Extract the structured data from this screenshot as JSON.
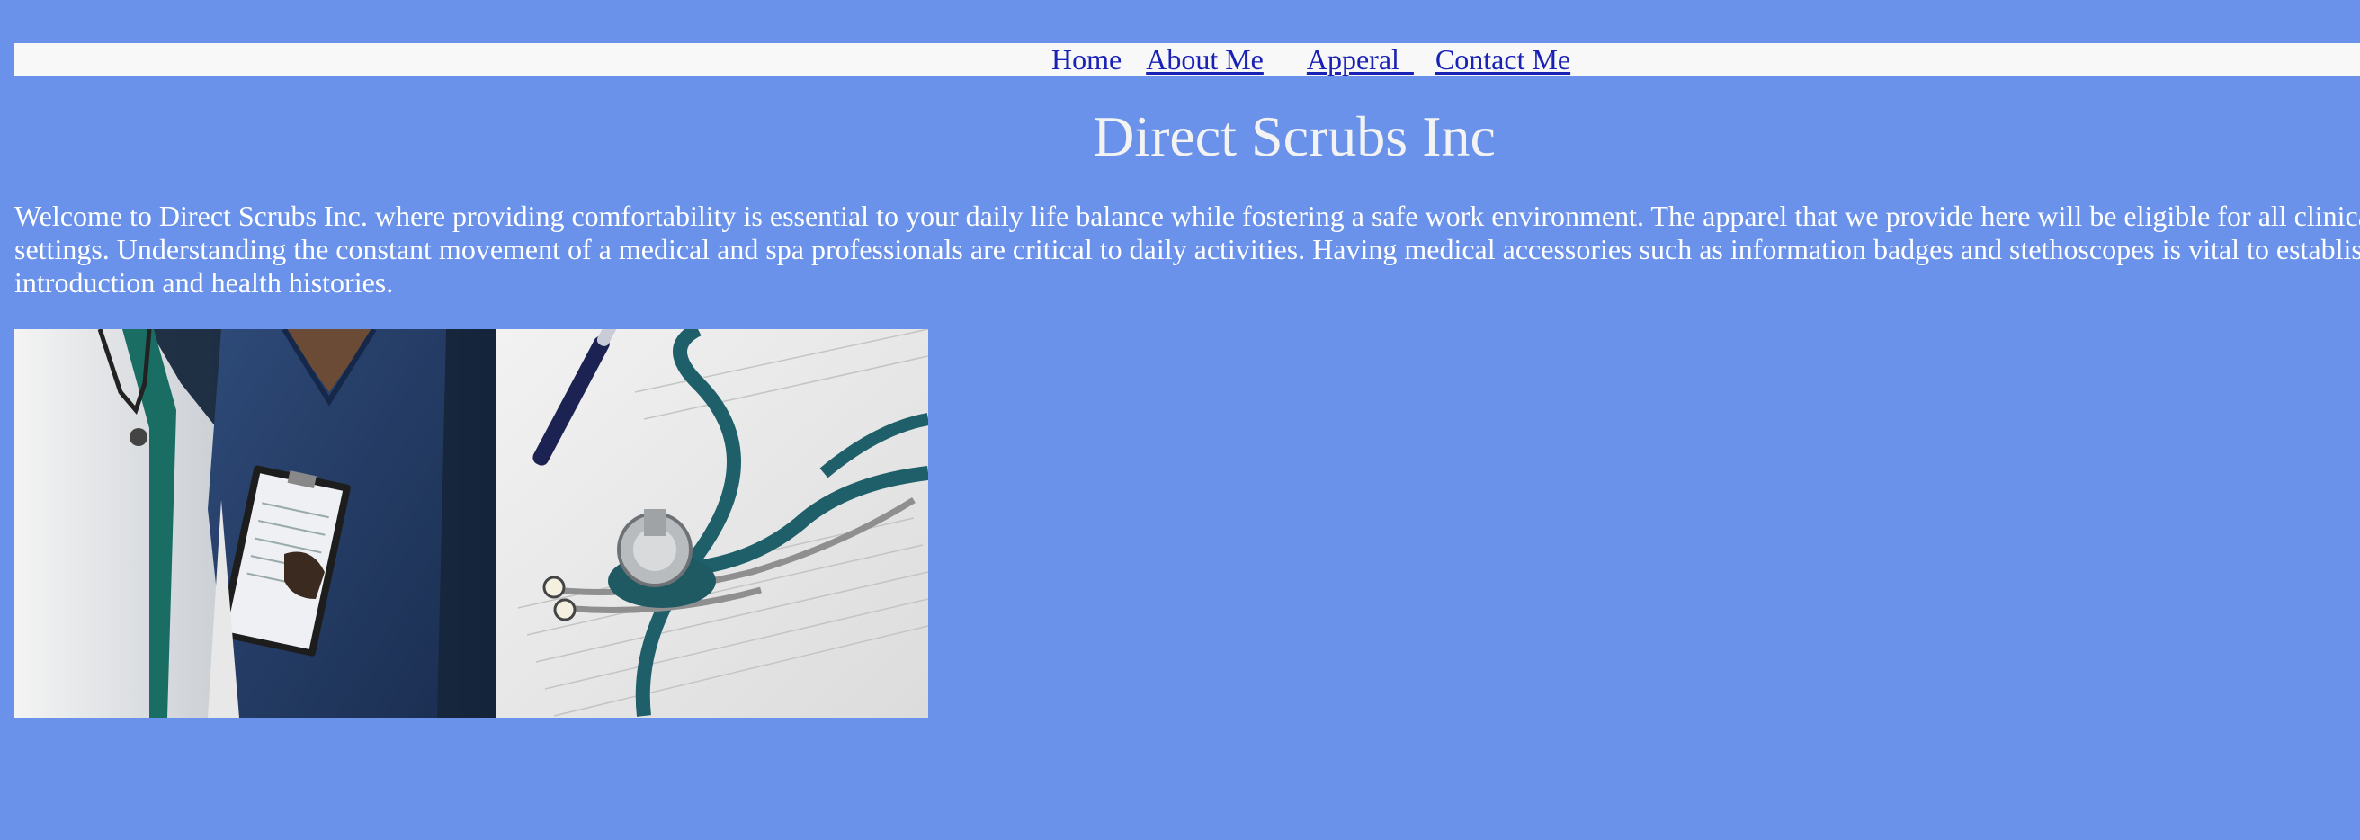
{
  "nav": {
    "items": [
      {
        "label": "Home"
      },
      {
        "label": "About Me"
      },
      {
        "label": "Apperal  "
      },
      {
        "label": "Contact Me"
      }
    ]
  },
  "page": {
    "title": "Direct Scrubs Inc",
    "intro": "Welcome to Direct Scrubs Inc. where providing comfortability is essential to your daily life balance while fostering a safe work environment. The apparel that we provide here will be eligible for all clinical settings. Understanding the constant movement of a medical and spa professionals are critical to daily activities. Having medical accessories such as information badges and stethoscopes is vital to establish introduction and health histories."
  },
  "colors": {
    "background": "#6a92ea",
    "nav_bar": "#f8f8f8",
    "link": "#1a21b5",
    "text": "#ffffff"
  },
  "images": {
    "hero": "medical-professionals-and-stethoscope-photo"
  }
}
